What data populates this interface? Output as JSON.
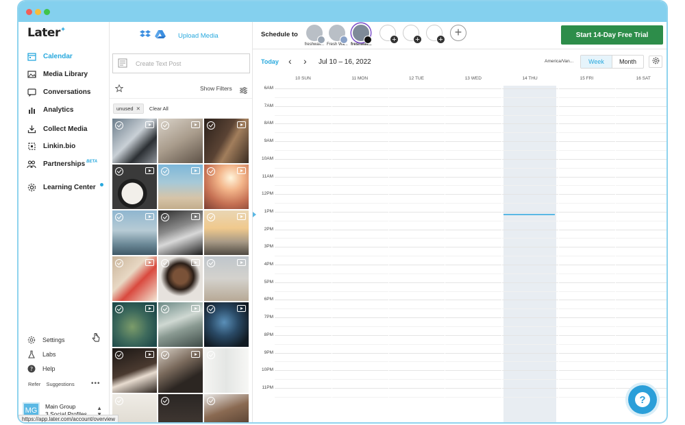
{
  "app": {
    "logo": "Later"
  },
  "sidebar": {
    "items": [
      {
        "label": "Calendar",
        "icon": "calendar-icon"
      },
      {
        "label": "Media Library",
        "icon": "image-icon"
      },
      {
        "label": "Conversations",
        "icon": "chat-icon"
      },
      {
        "label": "Analytics",
        "icon": "bar-chart-icon"
      },
      {
        "label": "Collect Media",
        "icon": "download-icon"
      },
      {
        "label": "Linkin.bio",
        "icon": "link-icon"
      },
      {
        "label": "Partnerships",
        "icon": "people-icon",
        "badge": "BETA"
      },
      {
        "label": "Learning Center",
        "icon": "gear-icon"
      }
    ],
    "bottom_items": [
      {
        "label": "Settings",
        "icon": "settings-icon"
      },
      {
        "label": "Labs",
        "icon": "flask-icon"
      },
      {
        "label": "Help",
        "icon": "help-icon"
      }
    ],
    "refer": "Refer",
    "suggestions": "Suggestions",
    "more": "•••",
    "group": {
      "initials": "MG",
      "name": "Main Group",
      "profiles": "3 Social Profiles"
    },
    "status_url": "https://app.later.com/account/overview"
  },
  "media": {
    "upload_label": "Upload Media",
    "create_post_placeholder": "Create Text Post",
    "show_filters": "Show Filters",
    "chip": "unused",
    "clear_all": "Clear All"
  },
  "topbar": {
    "schedule_to": "Schedule to",
    "profiles": [
      {
        "caption": "freshwav..."
      },
      {
        "caption": "Fresh Wa..."
      },
      {
        "caption": "freshwav..."
      }
    ],
    "trial_button": "Start 14-Day Free Trial"
  },
  "calendar": {
    "today": "Today",
    "date_range": "Jul 10 – 16, 2022",
    "timezone": "America/Van...",
    "view_week": "Week",
    "view_month": "Month",
    "days": [
      "10 SUN",
      "11 MON",
      "12 TUE",
      "13 WED",
      "14 THU",
      "15 FRI",
      "16 SAT"
    ],
    "hours": [
      "6AM",
      "7AM",
      "8AM",
      "9AM",
      "10AM",
      "11AM",
      "12PM",
      "1PM",
      "2PM",
      "3PM",
      "4PM",
      "5PM",
      "6PM",
      "7PM",
      "8PM",
      "9PM",
      "10PM",
      "11PM"
    ]
  },
  "help": {
    "icon": "?"
  },
  "colors": {
    "accent": "#27a8dd",
    "trial": "#2d8d4a",
    "titlebar": "#84d0ee"
  }
}
